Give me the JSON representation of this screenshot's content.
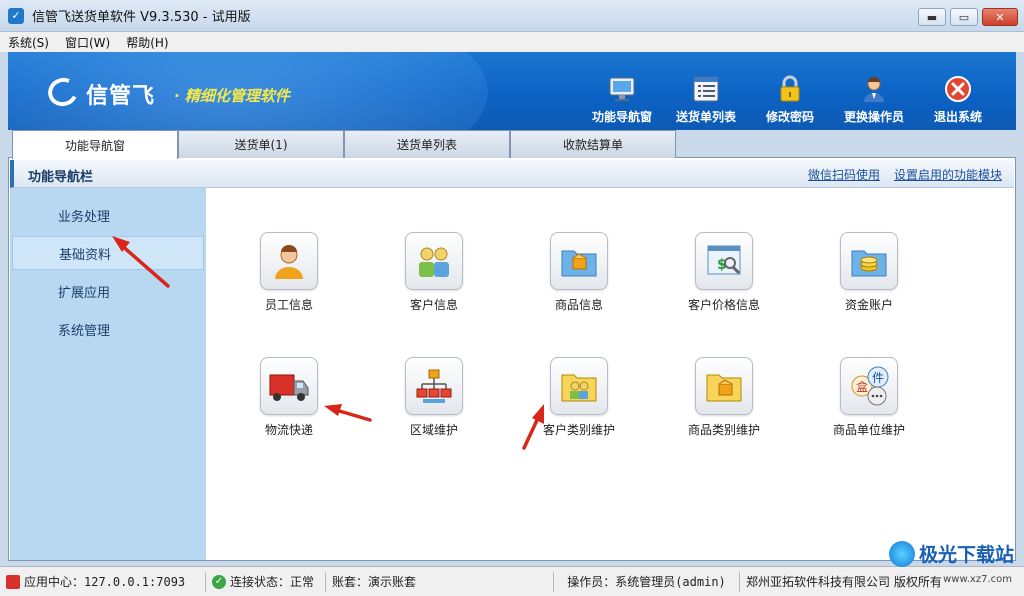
{
  "window": {
    "title": "信管飞送货单软件 V9.3.530 - 试用版",
    "min_glyph": "▬",
    "max_glyph": "▭",
    "close_glyph": "✕"
  },
  "menu": [
    "系统(S)",
    "窗口(W)",
    "帮助(H)"
  ],
  "banner": {
    "logo_text": "信管飞",
    "slogan": "· 精细化管理软件",
    "toolbar": [
      {
        "label": "功能导航窗",
        "icon": "monitor-icon"
      },
      {
        "label": "送货单列表",
        "icon": "list-icon"
      },
      {
        "label": "修改密码",
        "icon": "lock-icon"
      },
      {
        "label": "更换操作员",
        "icon": "user-icon"
      },
      {
        "label": "退出系统",
        "icon": "exit-icon"
      }
    ]
  },
  "tabs": [
    "功能导航窗",
    "送货单(1)",
    "送货单列表",
    "收款结算单"
  ],
  "panel": {
    "title": "功能导航栏",
    "links": [
      "微信扫码使用",
      "设置启用的功能模块"
    ]
  },
  "sidebar": {
    "items": [
      "业务处理",
      "基础资料",
      "扩展应用",
      "系统管理"
    ],
    "selected_index": 1
  },
  "functions": [
    {
      "label": "员工信息",
      "icon": "employee-icon"
    },
    {
      "label": "客户信息",
      "icon": "customers-icon"
    },
    {
      "label": "商品信息",
      "icon": "product-icon"
    },
    {
      "label": "客户价格信息",
      "icon": "customer-price-icon"
    },
    {
      "label": "资金账户",
      "icon": "funds-account-icon"
    },
    {
      "label": "物流快递",
      "icon": "truck-icon"
    },
    {
      "label": "区域维护",
      "icon": "region-tree-icon"
    },
    {
      "label": "客户类别维护",
      "icon": "customer-category-icon"
    },
    {
      "label": "商品类别维护",
      "icon": "product-category-icon"
    },
    {
      "label": "商品单位维护",
      "icon": "product-unit-icon"
    }
  ],
  "unit_icon_chars": {
    "top": "件",
    "left": "盒"
  },
  "status": {
    "app_center": "应用中心：127.0.0.1:7093",
    "connection": "连接状态：正常",
    "account": "账套：演示账套",
    "operator": "操作员：系统管理员(admin)",
    "copyright": "郑州亚拓软件科技有限公司 版权所有"
  },
  "watermark": {
    "text": "极光下载站",
    "url": "www.xz7.com"
  },
  "colors": {
    "banner": "#0c62c4",
    "slogan": "#f4e94a",
    "sidebar": "#b8d8f2",
    "arrow": "#d8261b"
  }
}
